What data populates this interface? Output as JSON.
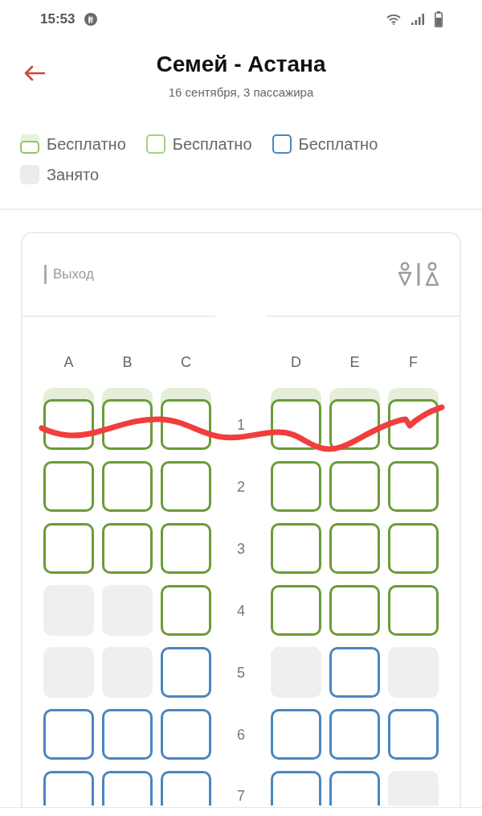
{
  "status_bar": {
    "time": "15:53"
  },
  "header": {
    "title": "Семей - Астана",
    "subtitle": "16 сентября, 3 пассажира"
  },
  "legend": [
    {
      "kind": "capped",
      "label": "Бесплатно"
    },
    {
      "kind": "green",
      "label": "Бесплатно"
    },
    {
      "kind": "blue",
      "label": "Бесплатно"
    },
    {
      "kind": "taken",
      "label": "Занято"
    }
  ],
  "seat_map": {
    "exit_label": "Выход",
    "columns": [
      "A",
      "B",
      "C",
      "D",
      "E",
      "F"
    ],
    "rows": [
      {
        "number": "1",
        "seats": [
          {
            "kind": "capped"
          },
          {
            "kind": "capped"
          },
          {
            "kind": "capped"
          },
          {
            "kind": "capped"
          },
          {
            "kind": "capped"
          },
          {
            "kind": "capped"
          }
        ]
      },
      {
        "number": "2",
        "seats": [
          {
            "kind": "green"
          },
          {
            "kind": "green"
          },
          {
            "kind": "green"
          },
          {
            "kind": "green"
          },
          {
            "kind": "green"
          },
          {
            "kind": "green"
          }
        ]
      },
      {
        "number": "3",
        "seats": [
          {
            "kind": "green"
          },
          {
            "kind": "green"
          },
          {
            "kind": "green"
          },
          {
            "kind": "green"
          },
          {
            "kind": "green"
          },
          {
            "kind": "green"
          }
        ]
      },
      {
        "number": "4",
        "seats": [
          {
            "kind": "taken"
          },
          {
            "kind": "taken"
          },
          {
            "kind": "green"
          },
          {
            "kind": "green"
          },
          {
            "kind": "green"
          },
          {
            "kind": "green"
          }
        ]
      },
      {
        "number": "5",
        "seats": [
          {
            "kind": "taken"
          },
          {
            "kind": "taken"
          },
          {
            "kind": "blue"
          },
          {
            "kind": "taken"
          },
          {
            "kind": "blue"
          },
          {
            "kind": "taken"
          }
        ]
      },
      {
        "number": "6",
        "seats": [
          {
            "kind": "blue"
          },
          {
            "kind": "blue"
          },
          {
            "kind": "blue"
          },
          {
            "kind": "blue"
          },
          {
            "kind": "blue"
          },
          {
            "kind": "blue"
          }
        ]
      },
      {
        "number": "7",
        "seats": [
          {
            "kind": "blue"
          },
          {
            "kind": "blue"
          },
          {
            "kind": "blue"
          },
          {
            "kind": "blue"
          },
          {
            "kind": "blue"
          },
          {
            "kind": "taken"
          }
        ]
      }
    ]
  }
}
